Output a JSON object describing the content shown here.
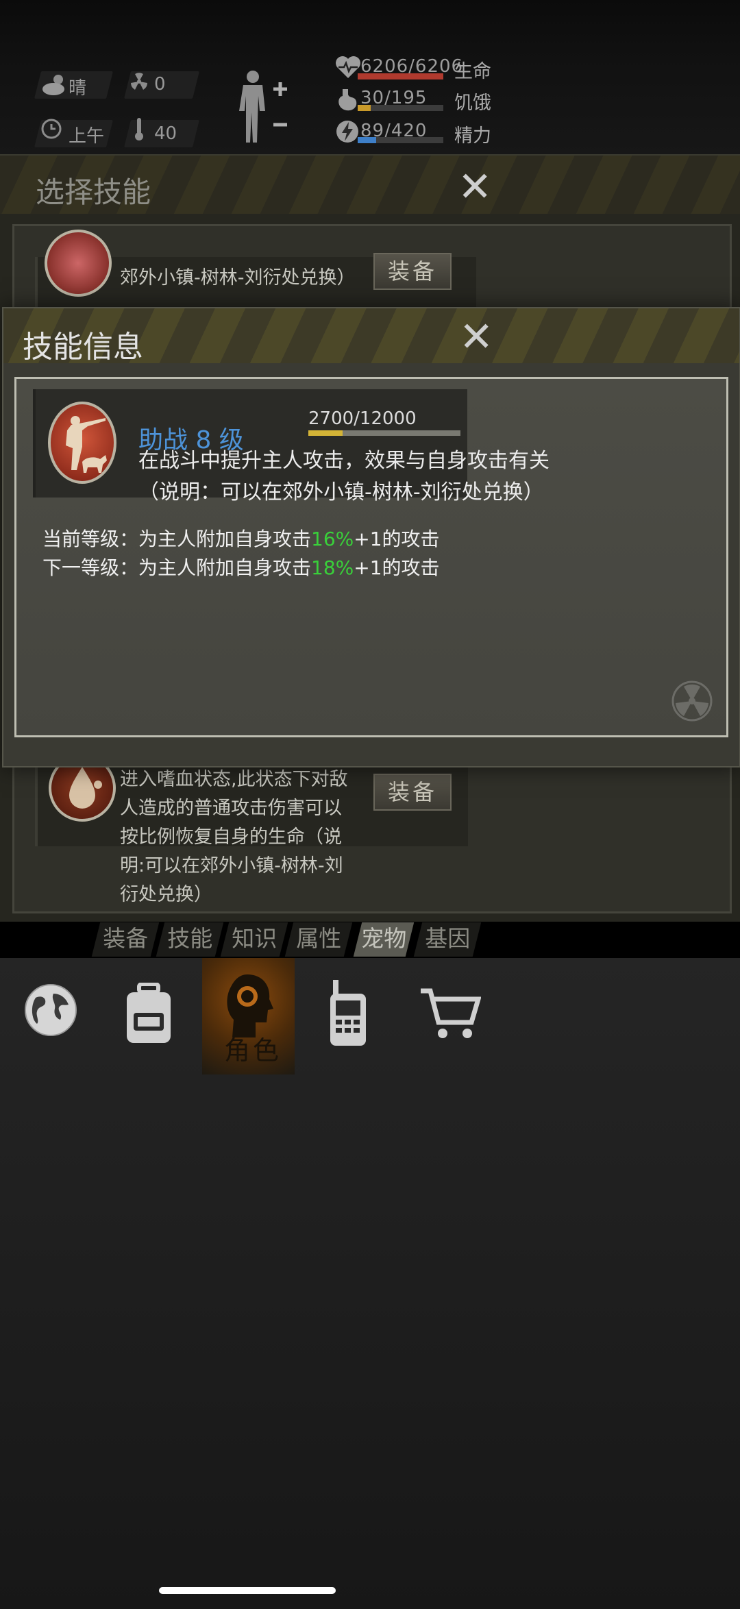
{
  "status": {
    "weather": "晴",
    "radiation": "0",
    "time_of_day": "上午",
    "temperature": "40"
  },
  "vitals": [
    {
      "name": "health",
      "value": "6206/6206",
      "label": "生命",
      "fill": 1.0,
      "color": "#b03a2e"
    },
    {
      "name": "hunger",
      "value": "30/195",
      "label": "饥饿",
      "fill": 0.154,
      "color": "#c99a2a"
    },
    {
      "name": "energy",
      "value": "89/420",
      "label": "精力",
      "fill": 0.212,
      "color": "#3e7fc8"
    }
  ],
  "select_skill": {
    "title": "选择技能",
    "card_top_text": "郊外小镇-树林-刘衍处兑换）",
    "card_bottom_text": "进入嗜血状态,此状态下对敌人造成的普通攻击伤害可以按比例恢复自身的生命（说明:可以在郊外小镇-树林-刘衍处兑换）",
    "equip_label": "装备"
  },
  "skill_info": {
    "title": "技能信息",
    "skill_name": "助战 8 级",
    "xp": "2700/12000",
    "xp_fraction": 0.225,
    "description": "在战斗中提升主人攻击，效果与自身攻击有关（说明：可以在郊外小镇-树林-刘衍处兑换）",
    "current_prefix": "当前等级：为主人附加自身攻击",
    "current_percent": "16%",
    "current_suffix": "+1的攻击",
    "next_prefix": "下一等级：为主人附加自身攻击",
    "next_percent": "18%",
    "next_suffix": "+1的攻击"
  },
  "tabs": [
    "装备",
    "技能",
    "知识",
    "属性",
    "宠物",
    "基因"
  ],
  "active_tab": "宠物",
  "bottom_nav": {
    "role_label": "角色"
  }
}
